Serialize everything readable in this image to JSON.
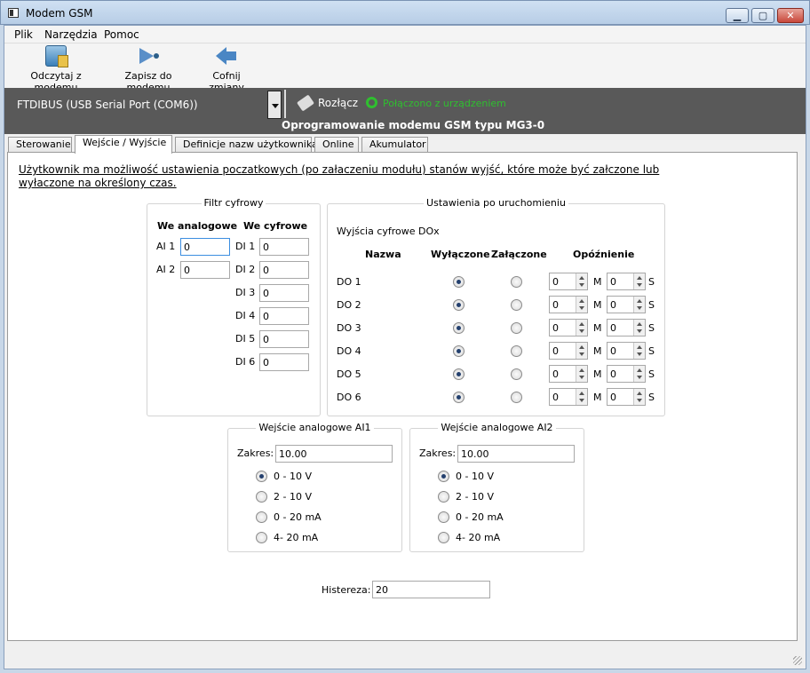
{
  "window": {
    "title": "Modem GSM"
  },
  "menu": [
    "Plik",
    "Narzędzia",
    "Pomoc"
  ],
  "toolbar": {
    "read": "Odczytaj z modemu",
    "write": "Zapisz do modemu",
    "undo": "Cofnij zmiany"
  },
  "connection": {
    "port": "FTDIBUS (USB Serial Port (COM6))",
    "disconnect": "Rozłącz",
    "status": "Połączono z urządzeniem",
    "firmware_title": "Oprogramowanie modemu GSM typu MG3-0"
  },
  "tabs": [
    "Sterowanie",
    "Wejście / Wyjście",
    "Definicje nazw użytkownika",
    "Online",
    "Akumulator"
  ],
  "intro": "Użytkownik ma możliwość ustawienia poczatkowych (po załaczeniu modułu) stanów wyjść, które może być załczone lub wyłaczone na określony czas.",
  "filter": {
    "title": "Filtr cyfrowy",
    "analog_header": "We analogowe",
    "digital_header": "We cyfrowe",
    "analog": [
      {
        "label": "AI 1",
        "value": "0"
      },
      {
        "label": "AI 2",
        "value": "0"
      }
    ],
    "digital": [
      {
        "label": "DI 1",
        "value": "0"
      },
      {
        "label": "DI 2",
        "value": "0"
      },
      {
        "label": "DI 3",
        "value": "0"
      },
      {
        "label": "DI 4",
        "value": "0"
      },
      {
        "label": "DI 5",
        "value": "0"
      },
      {
        "label": "DI 6",
        "value": "0"
      }
    ]
  },
  "startup": {
    "title": "Ustawienia po uruchomieniu",
    "subtitle": "Wyjścia cyfrowe DOx",
    "headers": {
      "name": "Nazwa",
      "off": "Wyłączone",
      "on": "Załączone",
      "delay": "Opóźnienie"
    },
    "min_unit": "M",
    "sec_unit": "S",
    "rows": [
      {
        "name": "DO 1",
        "state": "off",
        "min": "0",
        "sec": "0"
      },
      {
        "name": "DO 2",
        "state": "off",
        "min": "0",
        "sec": "0"
      },
      {
        "name": "DO 3",
        "state": "off",
        "min": "0",
        "sec": "0"
      },
      {
        "name": "DO 4",
        "state": "off",
        "min": "0",
        "sec": "0"
      },
      {
        "name": "DO 5",
        "state": "off",
        "min": "0",
        "sec": "0"
      },
      {
        "name": "DO 6",
        "state": "off",
        "min": "0",
        "sec": "0"
      }
    ]
  },
  "ai1": {
    "title": "Wejście analogowe AI1",
    "range_label": "Zakres:",
    "range_value": "10.00",
    "options": [
      "0 - 10 V",
      "2 - 10 V",
      "0 - 20 mA",
      "4- 20 mA"
    ],
    "selected": 0
  },
  "ai2": {
    "title": "Wejście analogowe AI2",
    "range_label": "Zakres:",
    "range_value": "10.00",
    "options": [
      "0 - 10 V",
      "2 - 10 V",
      "0 - 20 mA",
      "4- 20 mA"
    ],
    "selected": 0
  },
  "hysteresis": {
    "label": "Histereza:",
    "value": "20"
  }
}
